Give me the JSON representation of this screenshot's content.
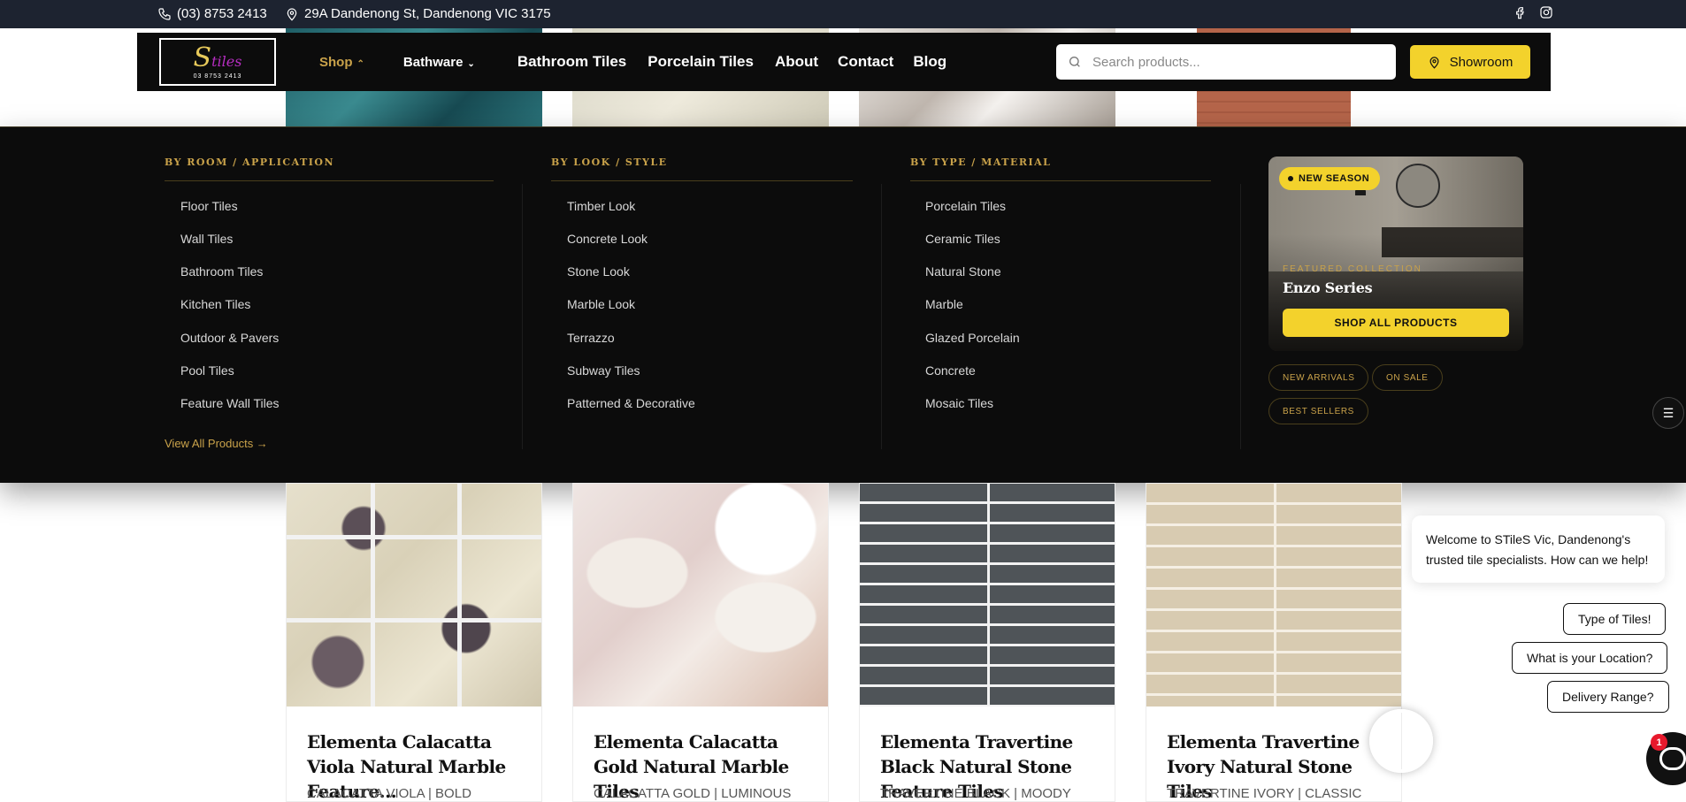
{
  "topbar": {
    "phone": "(03) 8753 2413",
    "address": "29A Dandenong St, Dandenong VIC 3175",
    "social_icons": [
      "facebook-icon",
      "instagram-icon"
    ]
  },
  "header": {
    "logo_phone": "03 8753 2413",
    "nav": [
      {
        "label": "Shop",
        "chevron": "⌃",
        "active": true
      },
      {
        "label": "Bathware",
        "chevron": "⌄"
      },
      {
        "label": "Bathroom Tiles"
      },
      {
        "label": "Porcelain Tiles"
      },
      {
        "label": "About"
      },
      {
        "label": "Contact"
      },
      {
        "label": "Blog"
      }
    ],
    "search_placeholder": "Search products...",
    "showroom_label": "Showroom"
  },
  "mega_menu": {
    "columns": [
      {
        "heading": "BY ROOM / APPLICATION",
        "links": [
          "Floor Tiles",
          "Wall Tiles",
          "Bathroom Tiles",
          "Kitchen Tiles",
          "Outdoor & Pavers",
          "Pool Tiles",
          "Feature Wall Tiles"
        ]
      },
      {
        "heading": "BY LOOK / STYLE",
        "links": [
          "Timber Look",
          "Concrete Look",
          "Stone Look",
          "Marble Look",
          "Terrazzo",
          "Subway Tiles",
          "Patterned & Decorative"
        ]
      },
      {
        "heading": "BY TYPE / MATERIAL",
        "links": [
          "Porcelain Tiles",
          "Ceramic Tiles",
          "Natural Stone",
          "Marble",
          "Glazed Porcelain",
          "Concrete",
          "Mosaic Tiles"
        ]
      }
    ],
    "view_all": "View All Products  →",
    "featured": {
      "badge": "NEW SEASON",
      "label": "FEATURED COLLECTION",
      "title": "Enzo Series",
      "button": "SHOP ALL PRODUCTS"
    },
    "tags": [
      "NEW ARRIVALS",
      "ON SALE",
      "BEST SELLERS"
    ]
  },
  "products": [
    {
      "title": "Elementa Calacatta Viola Natural Marble Feature…",
      "subtitle": "CALACATTA VIOLA | BOLD"
    },
    {
      "title": "Elementa Calacatta Gold Natural Marble Tiles",
      "subtitle": "CALACATTA GOLD | LUMINOUS"
    },
    {
      "title": "Elementa Travertine Black Natural Stone Feature Tiles",
      "subtitle": "TRAVERTINE BLACK | MOODY"
    },
    {
      "title": "Elementa Travertine Ivory Natural Stone Tiles",
      "subtitle": "TRAVERTINE IVORY | CLASSIC"
    }
  ],
  "chat": {
    "welcome": "Welcome to STileS Vic, Dandenong's trusted tile specialists. How can we help!",
    "quick_replies": [
      "Type of Tiles!",
      "What is your Location?",
      "Delivery Range?"
    ],
    "unread_count": "1"
  },
  "colors": {
    "accent_gold": "#c9a24a",
    "accent_yellow": "#f3d22c",
    "header_bg": "#0c0c0c",
    "topbar_bg": "#1d2330"
  }
}
